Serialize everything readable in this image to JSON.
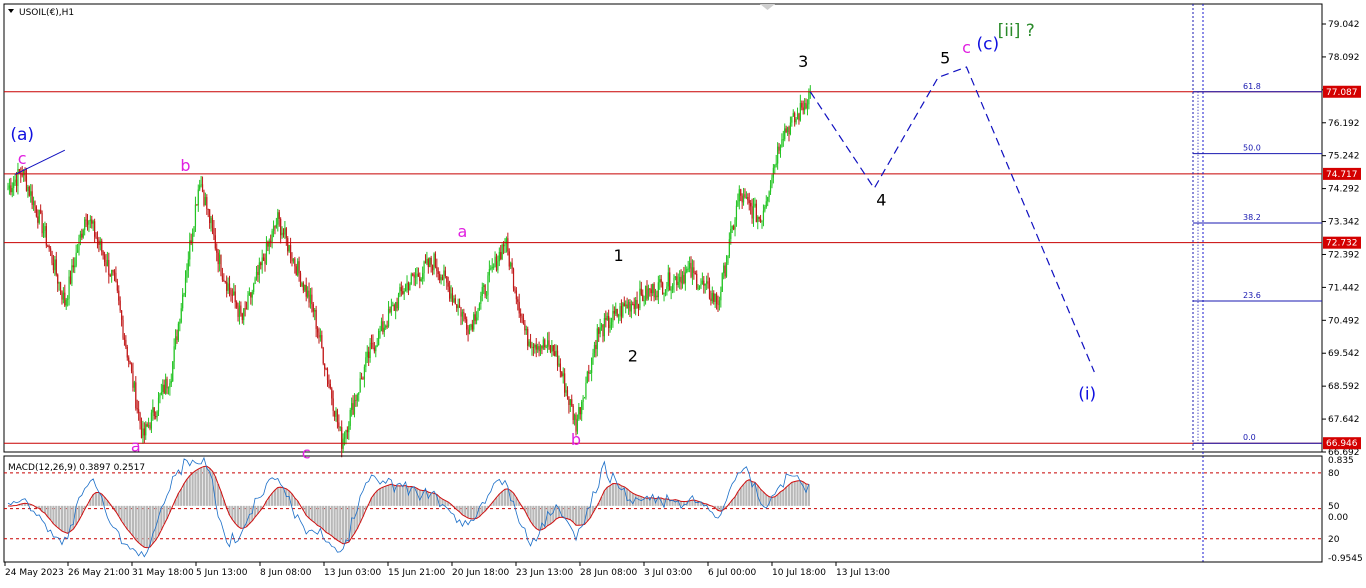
{
  "chart_data": {
    "type": "candlestick",
    "symbol_label": "USOIL(€),H1",
    "price_axis": {
      "ylim": [
        66.692,
        79.042
      ],
      "ticks": [
        79.042,
        78.092,
        77.142,
        76.192,
        75.242,
        74.292,
        73.342,
        72.392,
        71.442,
        70.492,
        69.542,
        68.592,
        67.642,
        66.692
      ],
      "tick_labels": [
        "79.042",
        "78.092",
        "77.142",
        "76.192",
        "75.242",
        "74.292",
        "73.342",
        "72.392",
        "71.442",
        "70.492",
        "69.542",
        "68.592",
        "67.642",
        "66.692"
      ]
    },
    "time_axis": {
      "labels": [
        "24 May 2023",
        "26 May 21:00",
        "31 May 18:00",
        "5 Jun 13:00",
        "8 Jun 08:00",
        "13 Jun 03:00",
        "15 Jun 21:00",
        "20 Jun 18:00",
        "23 Jun 13:00",
        "28 Jun 08:00",
        "3 Jul 03:00",
        "6 Jul 00:00",
        "10 Jul 18:00",
        "13 Jul 13:00"
      ]
    },
    "price_path": [
      [
        0,
        74.3
      ],
      [
        2,
        74.8
      ],
      [
        5,
        73.1
      ],
      [
        8,
        71.0
      ],
      [
        11,
        73.6
      ],
      [
        15,
        71.6
      ],
      [
        19,
        67.1
      ],
      [
        23,
        69.0
      ],
      [
        27,
        74.6
      ],
      [
        30,
        72.0
      ],
      [
        33,
        70.5
      ],
      [
        38,
        73.4
      ],
      [
        43,
        70.8
      ],
      [
        47,
        67.0
      ],
      [
        51,
        69.6
      ],
      [
        56,
        71.5
      ],
      [
        60,
        72.2
      ],
      [
        65,
        70.3
      ],
      [
        70,
        72.8
      ],
      [
        73,
        70.0
      ],
      [
        77,
        69.6
      ],
      [
        80,
        67.5
      ],
      [
        83,
        70.1
      ],
      [
        87,
        70.9
      ],
      [
        92,
        71.5
      ],
      [
        96,
        71.9
      ],
      [
        100,
        71.0
      ],
      [
        103,
        74.1
      ],
      [
        106,
        73.4
      ],
      [
        109,
        75.9
      ],
      [
        111,
        76.3
      ],
      [
        113,
        77.087
      ]
    ],
    "horizontal_levels": [
      {
        "value": 77.087,
        "label": "77.087"
      },
      {
        "value": 74.717,
        "label": "74.717"
      },
      {
        "value": 72.732,
        "label": "72.732"
      },
      {
        "value": 66.946,
        "label": "66.946"
      }
    ],
    "fibonacci": {
      "levels": [
        {
          "ratio_label": "61.8",
          "value": 77.087
        },
        {
          "ratio_label": "50.0",
          "value": 75.3
        },
        {
          "ratio_label": "38.2",
          "value": 73.3
        },
        {
          "ratio_label": "23.6",
          "value": 71.05
        },
        {
          "ratio_label": "0.0",
          "value": 66.946
        }
      ]
    },
    "projection_path": [
      [
        113,
        77.087
      ],
      [
        122,
        74.3
      ],
      [
        131,
        77.5
      ],
      [
        135,
        77.8
      ],
      [
        153,
        69.0
      ]
    ],
    "wave_labels": [
      {
        "text": "(a)",
        "bar": 2,
        "value": 75.7,
        "color": "#1010e0"
      },
      {
        "text": "c",
        "bar": 2,
        "value": 75.0,
        "color": "#e020e0"
      },
      {
        "text": "b",
        "bar": 25,
        "value": 74.8,
        "color": "#e020e0"
      },
      {
        "text": "a",
        "bar": 18,
        "value": 66.7,
        "color": "#e020e0"
      },
      {
        "text": "c",
        "bar": 42,
        "value": 66.5,
        "color": "#e020e0"
      },
      {
        "text": "a",
        "bar": 64,
        "value": 72.9,
        "color": "#e020e0"
      },
      {
        "text": "b",
        "bar": 80,
        "value": 66.9,
        "color": "#e020e0"
      },
      {
        "text": "1",
        "bar": 86,
        "value": 72.2,
        "color": "#000000"
      },
      {
        "text": "2",
        "bar": 88,
        "value": 69.3,
        "color": "#000000"
      },
      {
        "text": "3",
        "bar": 112,
        "value": 77.8,
        "color": "#000000"
      },
      {
        "text": "4",
        "bar": 123,
        "value": 73.8,
        "color": "#000000"
      },
      {
        "text": "5",
        "bar": 132,
        "value": 77.9,
        "color": "#000000"
      },
      {
        "text": "c",
        "bar": 135,
        "value": 78.2,
        "color": "#e020e0"
      },
      {
        "text": "(c)",
        "bar": 138,
        "value": 78.3,
        "color": "#1010e0"
      },
      {
        "text": "[ii] ?",
        "bar": 142,
        "value": 78.7,
        "color": "#2a8a2a"
      },
      {
        "text": "(i)",
        "bar": 152,
        "value": 68.2,
        "color": "#1010e0"
      }
    ]
  },
  "macd": {
    "label": "MACD(12,26,9) 0.3897 0.2517",
    "ylim": [
      -0.95,
      0.835
    ],
    "ticks": [
      {
        "value": 0.835,
        "label": "0.835"
      },
      {
        "value": 0.6,
        "label": "80"
      },
      {
        "value": 0.0,
        "label": "50"
      },
      {
        "value": -0.2,
        "label": "0.00"
      },
      {
        "value": -0.6,
        "label": "20"
      },
      {
        "value": -0.95,
        "label": "-0.9545"
      }
    ],
    "dashed_levels": [
      0.6,
      -0.05,
      -0.6
    ]
  },
  "colors": {
    "bull": "#22c322",
    "bear": "#c01818",
    "level_line": "#c80000",
    "level_badge": "#d40000",
    "fib": "#1818b0",
    "projection": "#1010c0",
    "macd_hist": "#b8b8b8",
    "macd_signal": "#d01010",
    "macd_main": "#1a6ec8",
    "divider": "#1818d0"
  }
}
